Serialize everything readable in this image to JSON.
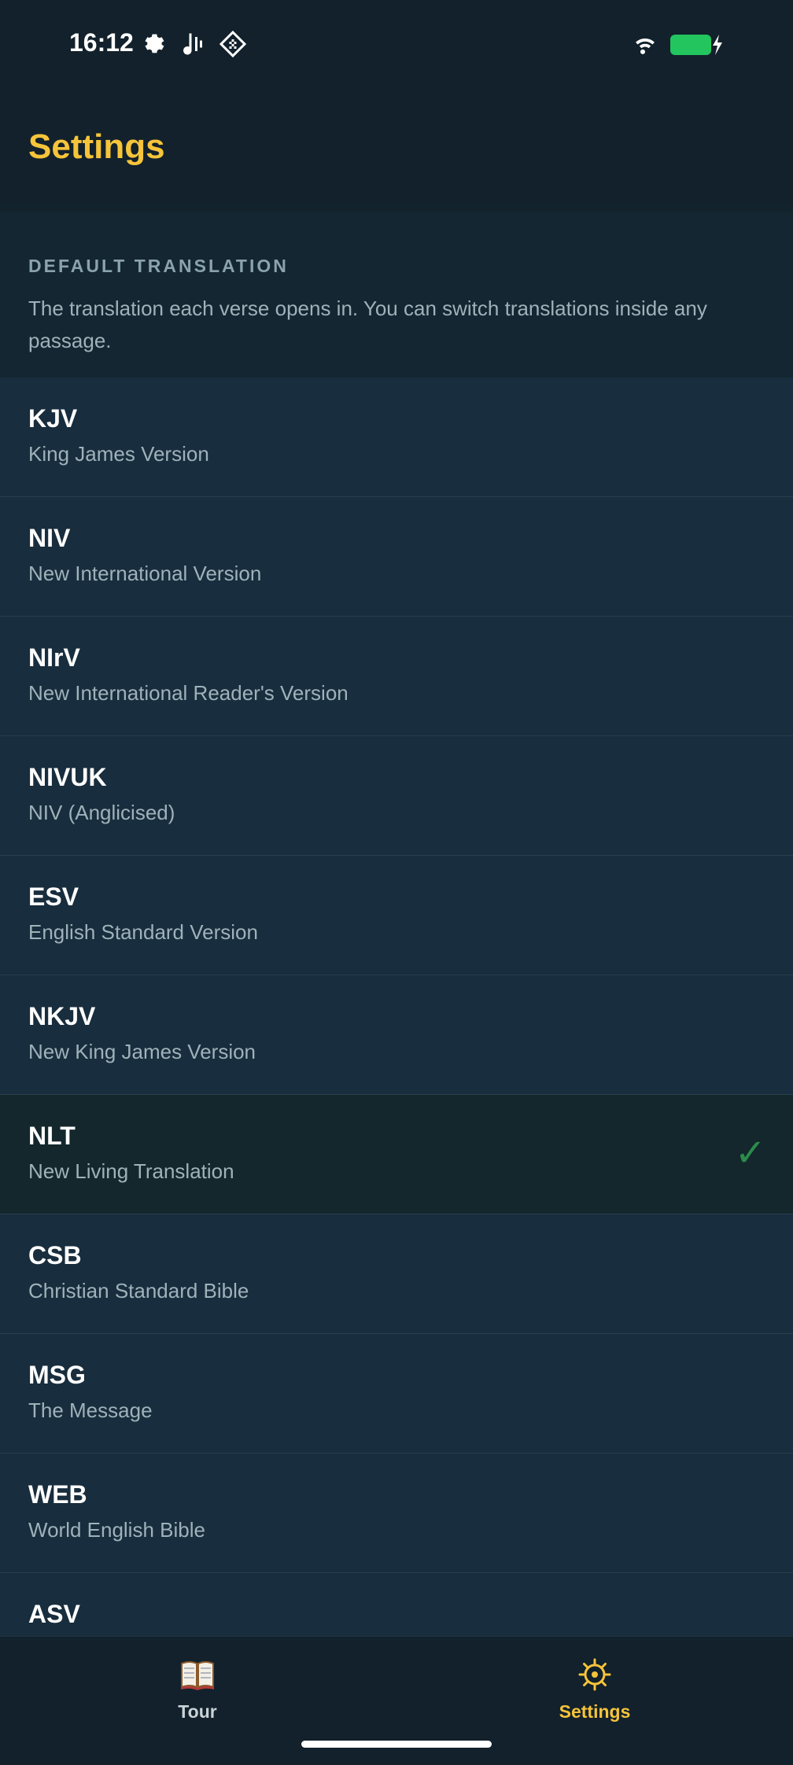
{
  "status_bar": {
    "time": "16:12",
    "icons": [
      "gear-icon",
      "music-note-icon",
      "diamond-grid-icon",
      "wifi-icon",
      "battery-charging-icon"
    ],
    "battery_color": "#22c55e"
  },
  "header": {
    "title": "Settings",
    "title_color": "#f6c43a"
  },
  "section": {
    "label": "DEFAULT TRANSLATION",
    "description": "The translation each verse opens in. You can switch translations inside any passage."
  },
  "translations": [
    {
      "code": "KJV",
      "name": "King James Version",
      "selected": false
    },
    {
      "code": "NIV",
      "name": "New International Version",
      "selected": false
    },
    {
      "code": "NIrV",
      "name": "New International Reader's Version",
      "selected": false
    },
    {
      "code": "NIVUK",
      "name": "NIV (Anglicised)",
      "selected": false
    },
    {
      "code": "ESV",
      "name": "English Standard Version",
      "selected": false
    },
    {
      "code": "NKJV",
      "name": "New King James Version",
      "selected": false
    },
    {
      "code": "NLT",
      "name": "New Living Translation",
      "selected": true
    },
    {
      "code": "CSB",
      "name": "Christian Standard Bible",
      "selected": false
    },
    {
      "code": "MSG",
      "name": "The Message",
      "selected": false
    },
    {
      "code": "WEB",
      "name": "World English Bible",
      "selected": false
    },
    {
      "code": "ASV",
      "name": "",
      "selected": false
    }
  ],
  "check_glyph": "✓",
  "bottom_nav": {
    "tour": {
      "label": "Tour",
      "icon": "book-icon",
      "color": "#c9d3d8"
    },
    "settings": {
      "label": "Settings",
      "icon": "sun-gear-icon",
      "color": "#f6c43a",
      "active": true
    }
  }
}
